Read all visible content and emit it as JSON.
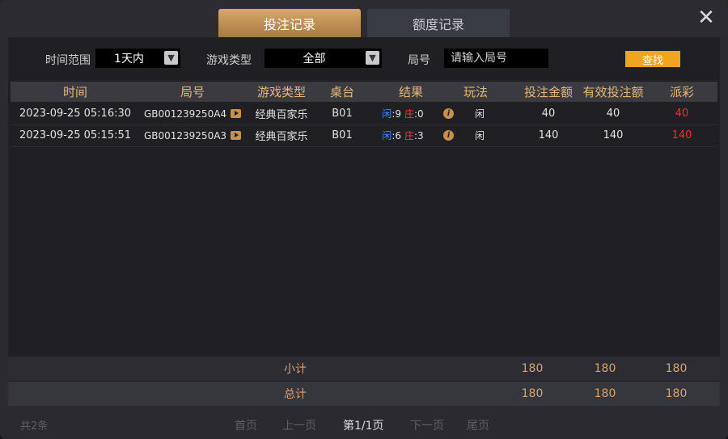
{
  "tabs": {
    "active": "投注记录",
    "inactive": "额度记录"
  },
  "filters": {
    "time_range_label": "时间范围",
    "time_range_value": "1天内",
    "game_type_label": "游戏类型",
    "game_type_value": "全部",
    "round_label": "局号",
    "round_placeholder": "请输入局号",
    "search_button": "查找"
  },
  "table": {
    "headers": [
      "时间",
      "局号",
      "游戏类型",
      "桌台",
      "结果",
      "玩法",
      "投注金额",
      "有效投注额",
      "派彩"
    ],
    "rows": [
      {
        "time": "2023-09-25 05:16:30",
        "round": "GB001239250A4",
        "game": "经典百家乐",
        "table": "B01",
        "player_label": "闲",
        "player_score": ":9",
        "banker_label": "庄",
        "banker_score": ":0",
        "play": "闲",
        "bet": "40",
        "valid_bet": "40",
        "payout": "40"
      },
      {
        "time": "2023-09-25 05:15:51",
        "round": "GB001239250A3",
        "game": "经典百家乐",
        "table": "B01",
        "player_label": "闲",
        "player_score": ":6",
        "banker_label": "庄",
        "banker_score": ":3",
        "play": "闲",
        "bet": "140",
        "valid_bet": "140",
        "payout": "140"
      }
    ]
  },
  "summary": {
    "subtotal": {
      "label": "小计",
      "bet": "180",
      "valid_bet": "180",
      "payout": "180"
    },
    "total": {
      "label": "总计",
      "bet": "180",
      "valid_bet": "180",
      "payout": "180"
    }
  },
  "footer": {
    "count": "共2条",
    "first": "首页",
    "prev": "上一页",
    "current": "第1/1页",
    "next": "下一页",
    "last": "尾页"
  },
  "colors": {
    "accent": "#d6a86a",
    "search_button": "#f0a520",
    "player": "#3b8cff",
    "banker": "#ff3a3a"
  },
  "icons": {
    "close": "close-icon",
    "replay": "play-icon",
    "info": "info-icon",
    "dropdown": "chevron-down-icon"
  }
}
